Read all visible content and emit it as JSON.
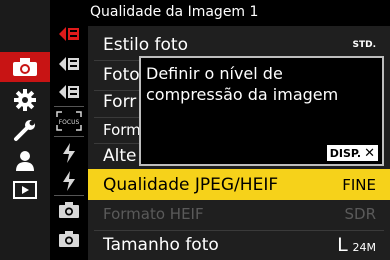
{
  "header": {
    "title": "Qualidade da Imagem 1"
  },
  "menu_rows": [
    {
      "label": "Estilo foto",
      "value": "STD."
    },
    {
      "label": "Foto",
      "value": ""
    },
    {
      "label": "Forr",
      "value": ""
    },
    {
      "label": "Form",
      "value": ""
    },
    {
      "label": "Alte",
      "value": ""
    },
    {
      "label": "Qualidade JPEG/HEIF",
      "value": "FINE"
    },
    {
      "label": "Formato HEIF",
      "value": "SDR"
    },
    {
      "label": "Tamanho foto",
      "value": "L",
      "value_sub": "24M"
    }
  ],
  "tooltip": {
    "text": "Definir o nível de compressão da imagem",
    "button_label": "DISP.",
    "button_icon": "close-icon"
  },
  "sub_icon_labels": {
    "focus": "FOCUS"
  },
  "colors": {
    "tab_active": "#c81414",
    "highlight": "#f6d21a",
    "submenu_active": "#e01b1b",
    "disabled": "#5a5a5a"
  }
}
